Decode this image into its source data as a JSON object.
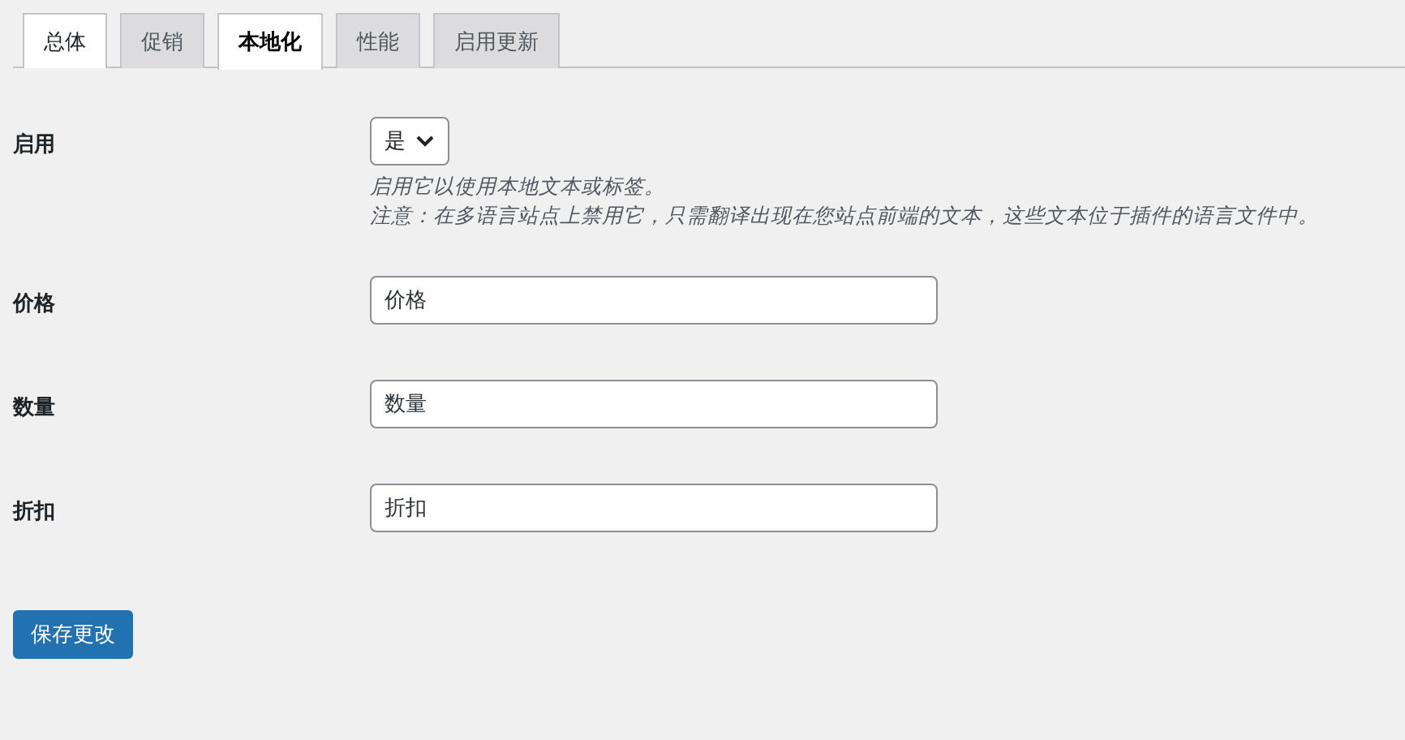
{
  "tabs": [
    {
      "label": "总体",
      "selected": false,
      "hovered": true
    },
    {
      "label": "促销",
      "selected": false,
      "hovered": false
    },
    {
      "label": "本地化",
      "selected": true,
      "hovered": false
    },
    {
      "label": "性能",
      "selected": false,
      "hovered": false
    },
    {
      "label": "启用更新",
      "selected": false,
      "hovered": false
    }
  ],
  "fields": [
    {
      "kind": "select",
      "label": "启用",
      "value": "是",
      "descriptions": [
        "启用它以使用本地文本或标签。",
        "注意：在多语言站点上禁用它，只需翻译出现在您站点前端的文本，这些文本位于插件的语言文件中。"
      ]
    },
    {
      "kind": "text",
      "label": "价格",
      "value": "价格"
    },
    {
      "kind": "text",
      "label": "数量",
      "value": "数量"
    },
    {
      "kind": "text",
      "label": "折扣",
      "value": "折扣"
    }
  ],
  "save_button": "保存更改"
}
